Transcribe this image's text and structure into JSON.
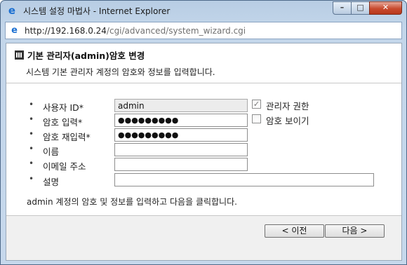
{
  "window": {
    "title": "시스템 설정 마법사 - Internet Explorer",
    "controls": {
      "minimize": "–",
      "maximize": "□",
      "close": "✕"
    }
  },
  "address": {
    "url_host": "http://192.168.0.24",
    "url_path": "/cgi/advanced/system_wizard.cgi"
  },
  "header": {
    "title": "기본 관리자(admin)암호 변경",
    "subtitle": "시스템 기본 관리자 계정의 암호와 정보를 입력합니다."
  },
  "form": {
    "bullet": "•",
    "fields": [
      {
        "label": "사용자 ID*",
        "value": "admin"
      },
      {
        "label": "암호 입력*",
        "value": "●●●●●●●●●"
      },
      {
        "label": "암호 재입력*",
        "value": "●●●●●●●●●"
      },
      {
        "label": "이름",
        "value": ""
      },
      {
        "label": "이메일 주소",
        "value": ""
      },
      {
        "label": "설명",
        "value": ""
      }
    ],
    "admin_rights": {
      "label": "관리자 권한",
      "checked": true,
      "mark": "✓"
    },
    "show_password": {
      "label": "암호 보이기",
      "checked": false,
      "mark": ""
    }
  },
  "instruction": "admin 계정의 암호 및 정보를 입력하고 다음을 클릭합니다.",
  "buttons": {
    "prev": "< 이전",
    "next": "다음 >"
  }
}
